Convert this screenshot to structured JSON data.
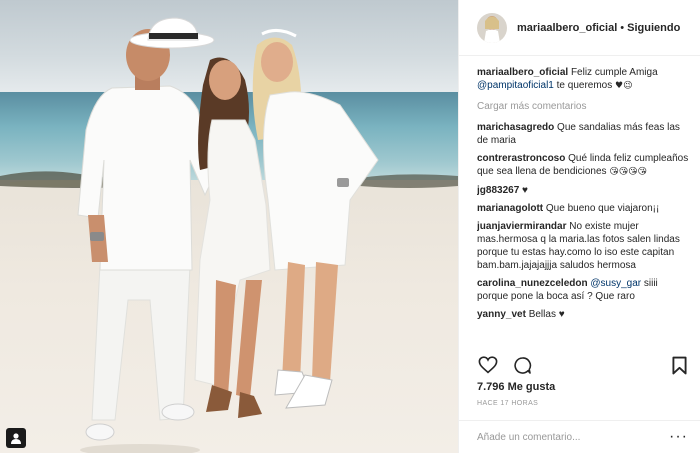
{
  "photo": {
    "alt": ""
  },
  "header": {
    "username": "mariaalbero_oficial",
    "separator": "•",
    "follow_status": "Siguiendo"
  },
  "caption": {
    "username": "mariaalbero_oficial",
    "text": "Feliz cumple Amiga",
    "mention": "@pampitaoficial1",
    "text_after": "te queremos",
    "emoji": "♥😉"
  },
  "load_more": "Cargar más comentarios",
  "comments": [
    {
      "user": "marichasagredo",
      "text": "Que sandalias más feas las de maria"
    },
    {
      "user": "contrerastroncoso",
      "text": "Qué linda feliz cumpleaños que sea llena de bendiciones",
      "emoji": "😘😘😘😘"
    },
    {
      "user": "jg883267",
      "text": "♥"
    },
    {
      "user": "marianagolott",
      "text": "Que bueno que viajaron¡¡"
    },
    {
      "user": "juanjaviermirandar",
      "text": "No existe mujer mas.hermosa q la maria.las fotos salen lindas porque tu estas hay.como lo iso este capitan bam.bam.jajajajjja saludos hermosa"
    },
    {
      "user": "carolina_nunezceledon",
      "mention": "@susy_gar",
      "text": "siiii porque pone la boca así ? Que raro"
    },
    {
      "user": "yanny_vet",
      "text": "Bellas ♥"
    }
  ],
  "likes": "7.796 Me gusta",
  "timestamp": "HACE 17 HORAS",
  "add_comment": {
    "placeholder": "Añade un comentario..."
  },
  "more_label": "···",
  "icons": {
    "like": "heart-icon",
    "comment": "comment-bubble-icon",
    "save": "bookmark-icon",
    "tag": "person-tag-icon"
  },
  "colors": {
    "link": "#003569",
    "muted": "#999999",
    "text": "#262626",
    "border": "#efefef"
  }
}
